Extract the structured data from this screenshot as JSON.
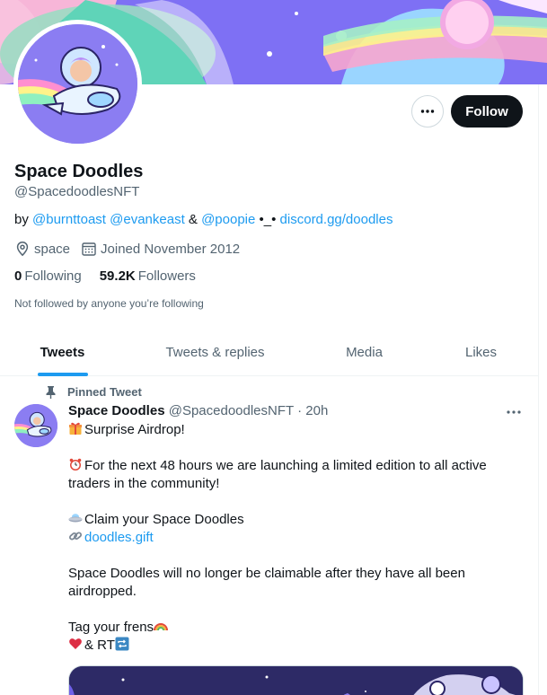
{
  "profile": {
    "name": "Space Doodles",
    "handle": "@SpacedoodlesNFT",
    "bio": {
      "prefix": "by ",
      "mention1": "@burnttoast",
      "mention2": "@evankeast",
      "amp": " & ",
      "mention3": "@poopie",
      "dots": " •_• ",
      "discord": "discord.gg/doodles"
    },
    "location": "space",
    "joined": "Joined November 2012",
    "following_count": "0",
    "following_label": "Following",
    "followers_count": "59.2K",
    "followers_label": "Followers",
    "not_followed": "Not followed by anyone you’re following"
  },
  "actions": {
    "more_icon": "more-horizontal-icon",
    "follow_label": "Follow"
  },
  "tabs": [
    {
      "label": "Tweets",
      "active": true
    },
    {
      "label": "Tweets & replies",
      "active": false
    },
    {
      "label": "Media",
      "active": false
    },
    {
      "label": "Likes",
      "active": false
    }
  ],
  "tweet": {
    "pinned_label": "Pinned Tweet",
    "author_name": "Space Doodles",
    "author_handle": "@SpacedoodlesNFT",
    "separator": " · ",
    "time": "20h",
    "line1": "Surprise Airdrop!",
    "line2": "For the next 48 hours we are launching a limited edition to all active traders in the community!",
    "line3": "Claim your Space Doodles",
    "link": "doodles.gift",
    "line4": "Space Doodles will no longer be claimable after they have all been airdropped.",
    "line5": "Tag your frens",
    "line6": "& RT"
  },
  "colors": {
    "accent": "#1d9bf0",
    "text": "#0f1419",
    "muted": "#536471",
    "follow_bg": "#0f1419"
  }
}
